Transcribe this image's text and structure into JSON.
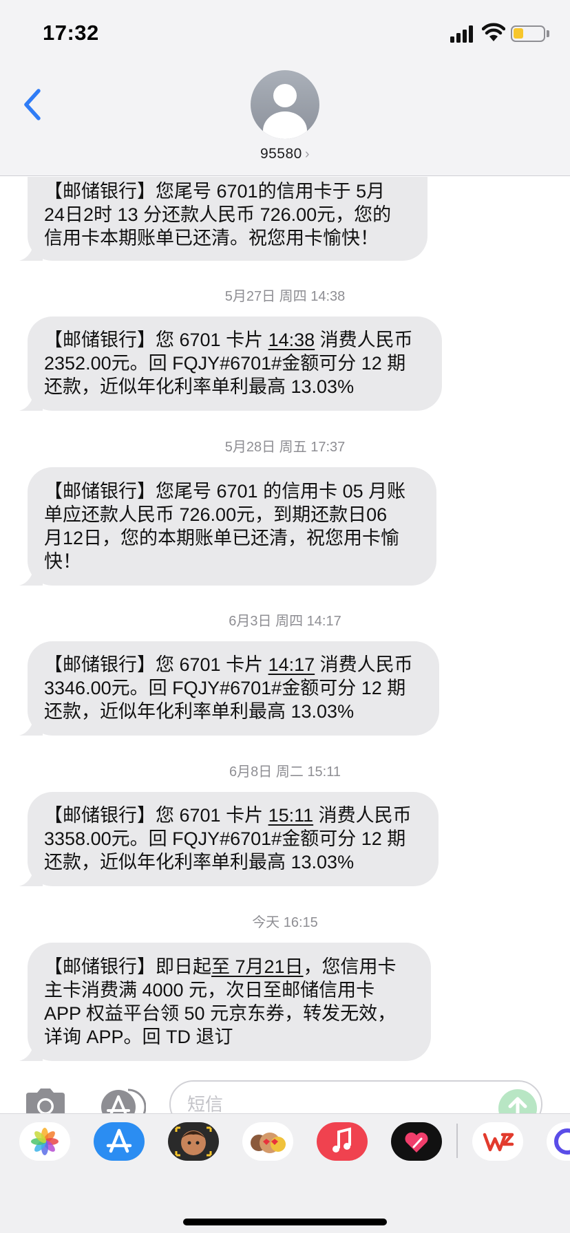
{
  "status_bar": {
    "time": "17:32"
  },
  "header": {
    "contact": "95580",
    "chevron": "›"
  },
  "messages": [
    {
      "lines": [
        "【邮储银行】您尾号 6701的信用卡于 5月",
        "24日2时 13 分还款人民币 726.00元，您的",
        "信用卡本期账单已还清。祝您用卡愉快！"
      ]
    },
    {
      "timestamp": "5月27日 周四 14:38",
      "pre": "【邮储银行】您 6701 卡片 ",
      "link": "14:38",
      "post": " 消费人民币",
      "lines": [
        "2352.00元。回 FQJY#6701#金额可分 12 期",
        "还款，近似年化利率单利最高 13.03%"
      ]
    },
    {
      "timestamp": "5月28日 周五 17:37",
      "lines": [
        "【邮储银行】您尾号 6701 的信用卡 05 月账",
        "单应还款人民币 726.00元，到期还款日06",
        "月12日，您的本期账单已还清，祝您用卡愉",
        "快！"
      ]
    },
    {
      "timestamp": "6月3日 周四 14:17",
      "pre": "【邮储银行】您 6701 卡片 ",
      "link": "14:17",
      "post": " 消费人民币",
      "lines": [
        "3346.00元。回 FQJY#6701#金额可分 12 期",
        "还款，近似年化利率单利最高 13.03%"
      ]
    },
    {
      "timestamp": "6月8日 周二 15:11",
      "pre": "【邮储银行】您 6701 卡片 ",
      "link": "15:11",
      "post": " 消费人民币",
      "lines": [
        "3358.00元。回 FQJY#6701#金额可分 12 期",
        "还款，近似年化利率单利最高 13.03%"
      ]
    },
    {
      "timestamp": "今天 16:15",
      "pre": "【邮储银行】即日起",
      "link": "至 7月21日",
      "post": "，您信用卡",
      "lines": [
        "主卡消费满 4000 元，次日至邮储信用卡",
        "APP 权益平台领 50 元京东券，转发无效，",
        "详询 APP。回 TD 退订"
      ]
    }
  ],
  "compose": {
    "placeholder": "短信"
  },
  "app_drawer": [
    "photos-app",
    "app-store-app",
    "memoji-app",
    "animoji-app",
    "music-app",
    "digital-touch-app",
    "wps-app",
    "more-app"
  ]
}
